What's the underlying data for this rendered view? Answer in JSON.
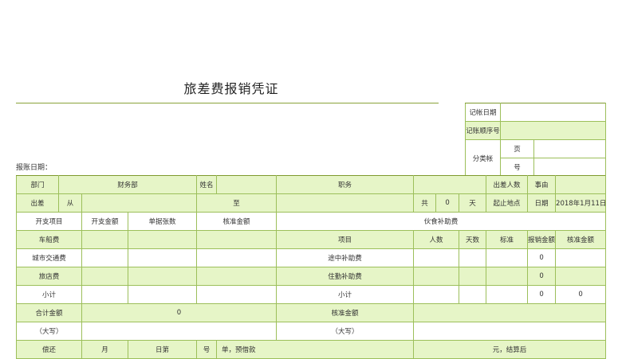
{
  "header": {
    "title": "旅差费报销凭证",
    "report_date_label": "报账日期："
  },
  "ledger": {
    "record_date_label": "记帐日期",
    "record_seq_label": "记账顺序号",
    "category_label": "分类帐",
    "page_label": "页",
    "number_label": "号"
  },
  "row1": {
    "dept_label": "部门",
    "dept_value": "财务部",
    "name_label": "姓名",
    "position_label": "职务",
    "travelers_label": "出差人数",
    "reason_label": "事由"
  },
  "row2": {
    "trip_label": "出差",
    "from_label": "从",
    "to_label": "至",
    "total_label": "共",
    "days_value": "0",
    "days_unit": "天",
    "route_label": "起止地点",
    "date_label": "日期",
    "date_value": "2018年1月11日"
  },
  "row3": {
    "expense_item": "开支项目",
    "expense_amount": "开支金额",
    "receipt_count": "单据张数",
    "approved_amount": "核准金额",
    "allowance_title": "伙食补助费"
  },
  "row4": {
    "label": "车船费",
    "item": "项目",
    "people": "人数",
    "days": "天数",
    "standard": "标准",
    "claim_amount": "报销金额",
    "approved_amount": "核准金额"
  },
  "row5": {
    "label": "城市交通费",
    "item": "途中补助费",
    "claim": "0"
  },
  "row6": {
    "label": "旅店费",
    "item": "住勤补助费",
    "claim": "0"
  },
  "row7": {
    "label": "小计",
    "item": "小计",
    "claim": "0",
    "approved": "0"
  },
  "row8": {
    "label": "合计金额",
    "value": "0",
    "approved_label": "核准金额"
  },
  "row9": {
    "capital_label": "（大写）",
    "capital_label2": "（大写）"
  },
  "row10": {
    "repay": "偿还",
    "month": "月",
    "day": "日第",
    "num": "号",
    "advance": "单，预借款",
    "settle": "元，结算后"
  }
}
